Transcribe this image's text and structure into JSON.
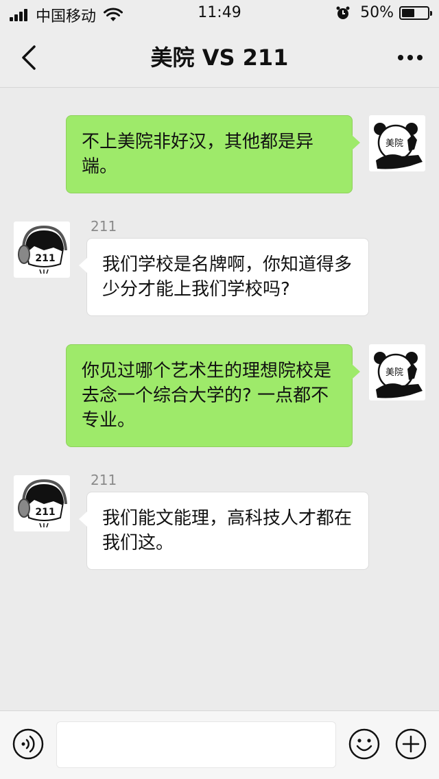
{
  "status_bar": {
    "carrier": "中国移动",
    "time": "11:49",
    "battery_text": "50%",
    "battery_level": 0.5
  },
  "nav": {
    "title": "美院 VS 211",
    "back_icon": "chevron-left-icon",
    "more_icon": "ellipsis-icon"
  },
  "avatars": {
    "me_label": "美院",
    "other_label": "211"
  },
  "messages": [
    {
      "from": "me",
      "text": "不上美院非好汉，其他都是异端。"
    },
    {
      "from": "other",
      "sender": "211",
      "text": "我们学校是名牌啊，你知道得多少分才能上我们学校吗?"
    },
    {
      "from": "me",
      "text": "你见过哪个艺术生的理想院校是去念一个综合大学的? 一点都不专业。"
    },
    {
      "from": "other",
      "sender": "211",
      "text": "我们能文能理，高科技人才都在我们这。"
    }
  ],
  "input_bar": {
    "voice_icon": "voice-icon",
    "emoji_icon": "emoji-icon",
    "plus_icon": "plus-icon",
    "input_value": ""
  },
  "colors": {
    "background": "#ebebeb",
    "my_bubble": "#9eea6a",
    "other_bubble": "#ffffff"
  }
}
